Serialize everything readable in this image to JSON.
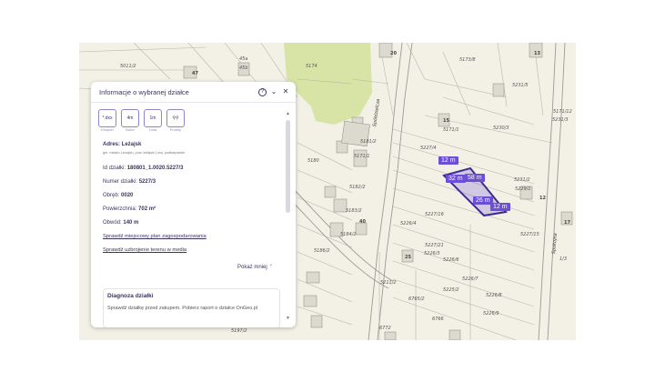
{
  "panel": {
    "title": "Informacje o wybranej działce",
    "help_icon": "help-circle-icon",
    "collapse_icon": "chevron-down-icon",
    "close_icon": "close-icon",
    "tools": [
      {
        "label": "Eksport",
        "icon_text": "*.dxx"
      },
      {
        "label": "Bufor",
        "icon_text": "4m"
      },
      {
        "label": "Linia",
        "icon_text": "1m"
      },
      {
        "label": "Punkty",
        "icon_text": "⚲⚲"
      }
    ],
    "address_label": "Adres: Leżajsk",
    "address_sub": "gm. miasto Leżajsk | pow. leżajski | woj. podkarpackie",
    "id_label": "Id działki:",
    "id_value": "180801_1.0020.5227/3",
    "number_label": "Numer działki:",
    "number_value": "5227/3",
    "obreb_label": "Obręb:",
    "obreb_value": "0020",
    "area_label": "Powierzchnia:",
    "area_value": "702 m²",
    "perimeter_label": "Obwód:",
    "perimeter_value": "140 m",
    "link_plan": "Sprawdź miejscowy plan zagospodarowania",
    "link_media": "Sprawdź uzbrojenie terenu w media",
    "show_less": "Pokaż mniej",
    "diag_title": "Diagnoza działki",
    "diag_text": "Sprawdź działkę przed zakupem. Pobierz raport o działce OnGeo.pl"
  },
  "map": {
    "measurements": [
      "12 m",
      "32 m",
      "58 m",
      "26 m",
      "12 m"
    ],
    "street_labels": [
      "Spółdzielcza",
      "Spokojna"
    ],
    "parcel_labels": [
      "5011/2",
      "47",
      "45a",
      "45b",
      "5174",
      "20",
      "5173/8",
      "13",
      "5231/5",
      "5231/3",
      "5230/3",
      "5171/1",
      "5227/4",
      "15",
      "5181/2",
      "5180",
      "5182/2",
      "5231/2",
      "5229/1",
      "12",
      "5183/2",
      "5184/2",
      "40",
      "5226/4",
      "5227/15",
      "5227/21",
      "5227/16",
      "17",
      "5186/2",
      "5226/3",
      "5226/6",
      "25",
      "5211/2",
      "5225/2",
      "5226/7",
      "5226/8",
      "5226/9",
      "6765/2",
      "6772",
      "6766",
      "1/3",
      "5197/2",
      "5171/12",
      "5171/1"
    ],
    "parcel_color": "#3b2d8f",
    "measure_color": "#6b4fd6"
  }
}
